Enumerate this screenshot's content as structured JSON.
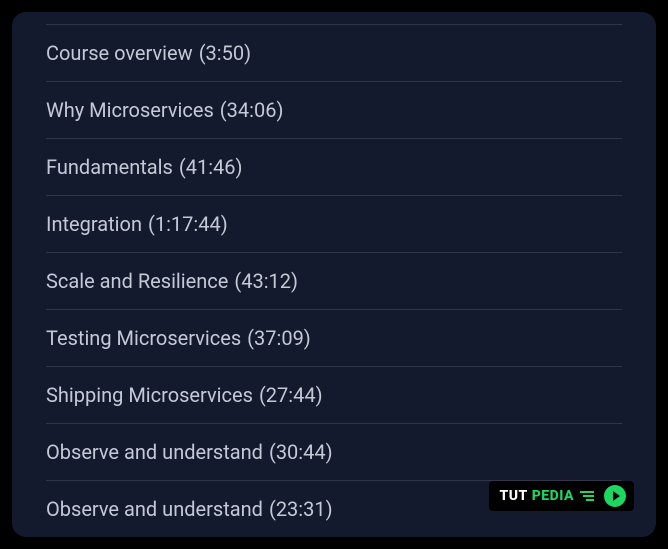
{
  "course_items": [
    {
      "title": "Course overview",
      "duration": "(3:50)"
    },
    {
      "title": "Why Microservices",
      "duration": "(34:06)"
    },
    {
      "title": "Fundamentals",
      "duration": "(41:46)"
    },
    {
      "title": "Integration",
      "duration": "(1:17:44)"
    },
    {
      "title": "Scale and Resilience",
      "duration": "(43:12)"
    },
    {
      "title": "Testing Microservices",
      "duration": "(37:09)"
    },
    {
      "title": "Shipping Microservices",
      "duration": "(27:44)"
    },
    {
      "title": "Observe and understand",
      "duration": "(30:44)"
    },
    {
      "title": "Observe and understand",
      "duration": "(23:31)"
    }
  ],
  "badge": {
    "tut": "TUT",
    "pedia": "PEDIA"
  }
}
